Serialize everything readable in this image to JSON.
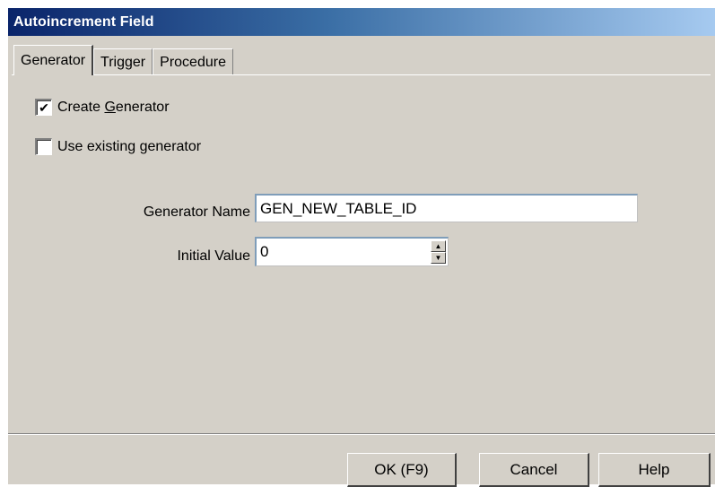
{
  "window": {
    "title": "Autoincrement Field"
  },
  "tabs": [
    {
      "label": "Generator",
      "active": true
    },
    {
      "label": "Trigger",
      "active": false
    },
    {
      "label": "Procedure",
      "active": false
    }
  ],
  "generator": {
    "create_generator": {
      "label_pre": "Create ",
      "label_mnemonic": "G",
      "label_post": "enerator",
      "checked": true,
      "mark": "✔"
    },
    "use_existing": {
      "label": "Use existing generator",
      "checked": false
    },
    "name_label": "Generator Name",
    "name_value": "GEN_NEW_TABLE_ID",
    "initial_label": "Initial Value",
    "initial_value": "0",
    "stepper_up": "▲",
    "stepper_down": "▼"
  },
  "buttons": {
    "ok": "OK (F9)",
    "cancel": "Cancel",
    "help": "Help"
  },
  "colors": {
    "title_gradient_start": "#0a246a",
    "title_gradient_end": "#a6caf0",
    "face": "#d4d0c8"
  }
}
